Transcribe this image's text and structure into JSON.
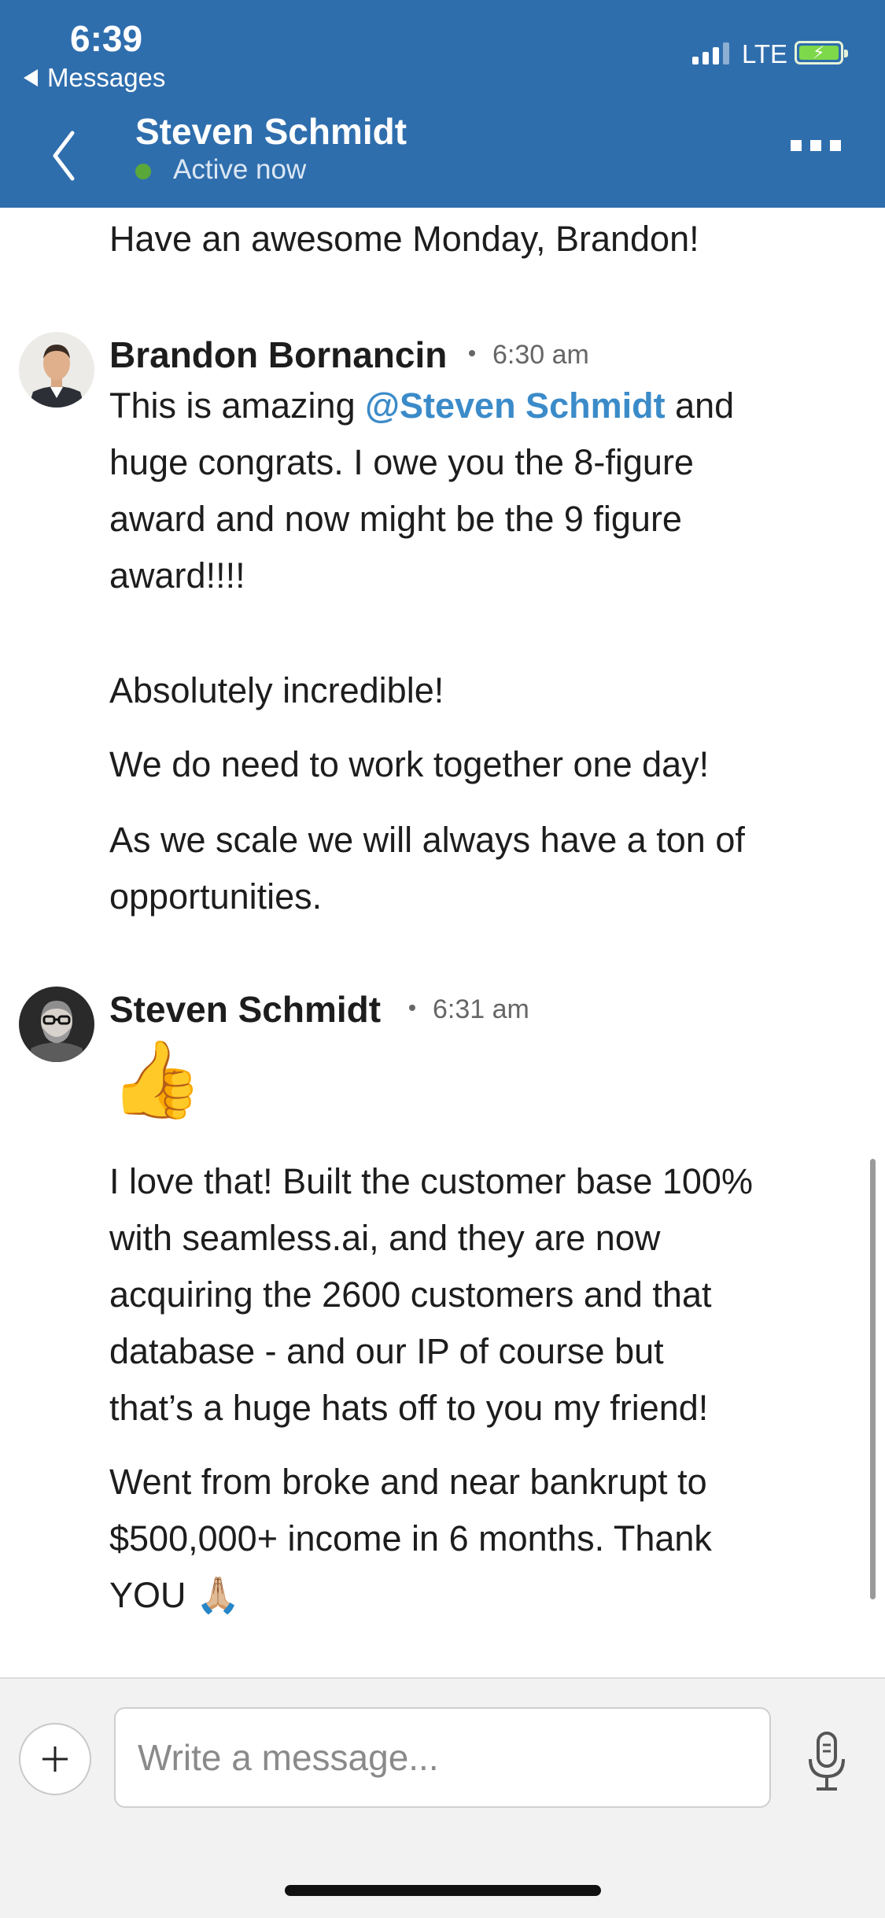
{
  "status_bar": {
    "time": "6:39",
    "back_app": "Messages",
    "network": "LTE"
  },
  "header": {
    "contact_name": "Steven Schmidt",
    "presence": "Active now"
  },
  "messages": {
    "m0": {
      "text": "Have an awesome Monday, Brandon!"
    },
    "brandon": {
      "sender": "Brandon Bornancin",
      "time": "6:30 am",
      "p1_a": "This is amazing ",
      "p1_mention": "@Steven Schmidt",
      "p1_b": " and",
      "p1_l2": "huge congrats. I owe you the 8-figure",
      "p1_l3": "award and now might be the 9 figure",
      "p1_l4": "award!!!!",
      "p2": "Absolutely incredible!",
      "p3": "We do need to work together one day!",
      "p4_l1": "As we scale we will always have a ton of",
      "p4_l2": "opportunities."
    },
    "steven": {
      "sender": "Steven Schmidt",
      "time": "6:31 am",
      "emoji": "👍",
      "p1_l1": "I love that!  Built the customer base 100%",
      "p1_l2": "with seamless.ai, and they are now",
      "p1_l3": "acquiring the 2600 customers and that",
      "p1_l4": "database - and our IP of course but",
      "p1_l5": "that’s a huge hats off to you my friend!",
      "p2_l1": "Went from broke and near bankrupt to",
      "p2_l2": "$500,000+ income in 6 months.  Thank",
      "p2_l3": "YOU",
      "p2_emoji": "🙏🏼"
    }
  },
  "composer": {
    "placeholder": "Write a message..."
  },
  "colors": {
    "header_bg": "#2f6ead",
    "mention": "#3b8bc9",
    "active": "#5aa83a"
  },
  "icons": [
    "back-arrow-icon",
    "more-icon",
    "plus-icon",
    "microphone-icon",
    "thumbs-up-emoji",
    "praying-hands-emoji"
  ]
}
